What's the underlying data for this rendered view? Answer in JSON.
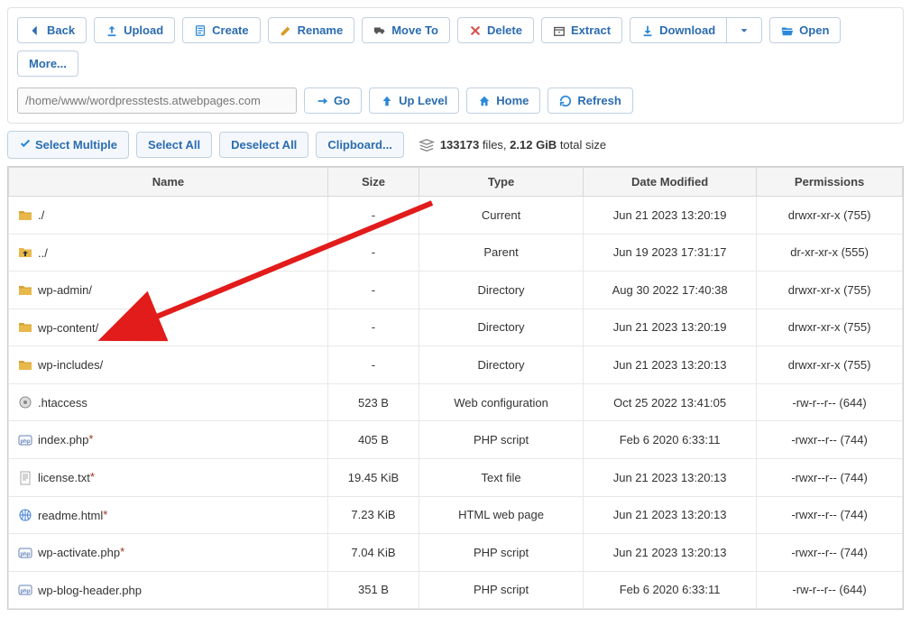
{
  "toolbar": {
    "back": "Back",
    "upload": "Upload",
    "create": "Create",
    "rename": "Rename",
    "move_to": "Move To",
    "delete": "Delete",
    "extract": "Extract",
    "download": "Download",
    "open": "Open",
    "more": "More..."
  },
  "path": "/home/www/wordpresstests.atwebpages.com",
  "nav": {
    "go": "Go",
    "up_level": "Up Level",
    "home": "Home",
    "refresh": "Refresh"
  },
  "selection": {
    "select_multiple": "Select Multiple",
    "select_all": "Select All",
    "deselect_all": "Deselect All",
    "clipboard": "Clipboard..."
  },
  "stats": {
    "count": "133173",
    "count_suffix": " files, ",
    "size": "2.12 GiB",
    "size_suffix": " total size"
  },
  "columns": {
    "name": "Name",
    "size": "Size",
    "type": "Type",
    "date": "Date Modified",
    "perm": "Permissions"
  },
  "rows": [
    {
      "icon": "folder",
      "name": "./",
      "modified": false,
      "size": "-",
      "type": "Current",
      "date": "Jun 21 2023 13:20:19",
      "perm": "drwxr-xr-x (755)"
    },
    {
      "icon": "folder-up",
      "name": "../",
      "modified": false,
      "size": "-",
      "type": "Parent",
      "date": "Jun 19 2023 17:31:17",
      "perm": "dr-xr-xr-x (555)"
    },
    {
      "icon": "folder",
      "name": "wp-admin/",
      "modified": false,
      "size": "-",
      "type": "Directory",
      "date": "Aug 30 2022 17:40:38",
      "perm": "drwxr-xr-x (755)"
    },
    {
      "icon": "folder",
      "name": "wp-content/",
      "modified": false,
      "size": "-",
      "type": "Directory",
      "date": "Jun 21 2023 13:20:19",
      "perm": "drwxr-xr-x (755)"
    },
    {
      "icon": "folder",
      "name": "wp-includes/",
      "modified": false,
      "size": "-",
      "type": "Directory",
      "date": "Jun 21 2023 13:20:13",
      "perm": "drwxr-xr-x (755)"
    },
    {
      "icon": "gear",
      "name": ".htaccess",
      "modified": false,
      "size": "523 B",
      "type": "Web configuration",
      "date": "Oct 25 2022 13:41:05",
      "perm": "-rw-r--r-- (644)"
    },
    {
      "icon": "php",
      "name": "index.php",
      "modified": true,
      "size": "405 B",
      "type": "PHP script",
      "date": "Feb 6 2020 6:33:11",
      "perm": "-rwxr--r-- (744)"
    },
    {
      "icon": "text",
      "name": "license.txt",
      "modified": true,
      "size": "19.45 KiB",
      "type": "Text file",
      "date": "Jun 21 2023 13:20:13",
      "perm": "-rwxr--r-- (744)"
    },
    {
      "icon": "html",
      "name": "readme.html",
      "modified": true,
      "size": "7.23 KiB",
      "type": "HTML web page",
      "date": "Jun 21 2023 13:20:13",
      "perm": "-rwxr--r-- (744)"
    },
    {
      "icon": "php",
      "name": "wp-activate.php",
      "modified": true,
      "size": "7.04 KiB",
      "type": "PHP script",
      "date": "Jun 21 2023 13:20:13",
      "perm": "-rwxr--r-- (744)"
    },
    {
      "icon": "php",
      "name": "wp-blog-header.php",
      "modified": false,
      "size": "351 B",
      "type": "PHP script",
      "date": "Feb 6 2020 6:33:11",
      "perm": "-rw-r--r-- (644)"
    }
  ]
}
